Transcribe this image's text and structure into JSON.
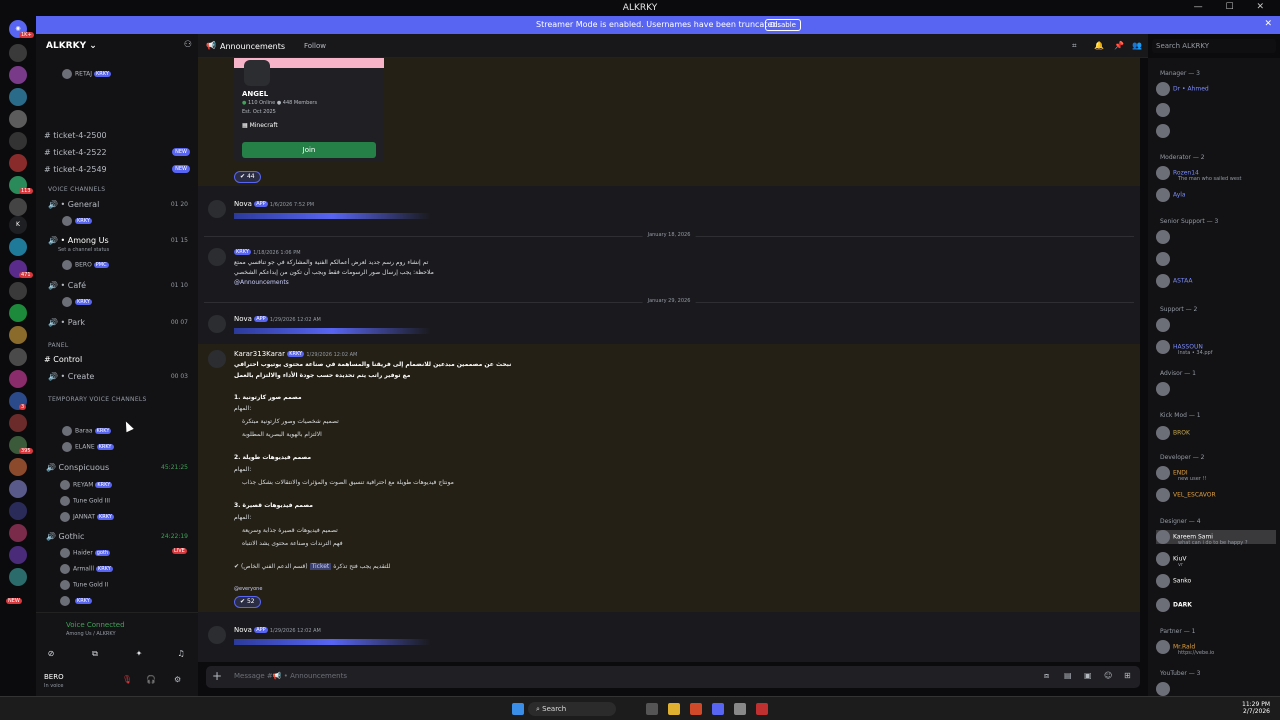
{
  "window": {
    "title": "ALKRKY"
  },
  "banner": {
    "message": "Streamer Mode is enabled. Usernames have been truncated.",
    "disable_label": "Disable"
  },
  "server": {
    "name": "ALKRKY"
  },
  "guild_badges": [
    "1K+",
    "113",
    "471",
    "3",
    "395",
    "NEW"
  ],
  "guild_k": "K",
  "channels": {
    "top_user": {
      "name": "RETAJ",
      "tag": "KRKY"
    },
    "ticket_items": [
      {
        "label": "ticket-4-2500",
        "badge": ""
      },
      {
        "label": "ticket-4-2522",
        "badge": "NEW"
      },
      {
        "label": "ticket-4-2549",
        "badge": "NEW"
      }
    ],
    "voice_category": "VOICE CHANNELS",
    "voice_items": [
      {
        "label": "General",
        "count": "01 20",
        "user": "KRKY",
        "user_name": ""
      },
      {
        "label": "Among Us",
        "count": "01 15",
        "sub": "Set a channel status",
        "user": "PMC",
        "user_name": "BERO"
      },
      {
        "label": "Café",
        "count": "01 10",
        "user": "KRKY",
        "user_name": ""
      },
      {
        "label": "Park",
        "count": "00 07"
      }
    ],
    "panel_category": "PANEL",
    "panel_items": [
      {
        "label": "Control"
      },
      {
        "label": "Create",
        "count": "00 03"
      }
    ],
    "temp_category": "TEMPORARY VOICE CHANNELS",
    "temp_users": [
      {
        "name": "Baraa",
        "tag": "KRKY"
      },
      {
        "name": "ELANE",
        "tag": "KRKY"
      }
    ],
    "conspicuous": {
      "label": "Conspicuous",
      "time": "45:21:25",
      "users": [
        {
          "name": "REYAM",
          "tag": "KRKY"
        },
        {
          "name": "Tune Gold III",
          "tag": ""
        },
        {
          "name": "JANNAT",
          "tag": "KRKY"
        }
      ]
    },
    "gothic": {
      "label": "Gothic",
      "time": "24:22:19",
      "live": "LIVE",
      "users": [
        {
          "name": "Haider",
          "tag": "goth"
        },
        {
          "name": "Armalll",
          "tag": "KRKY"
        },
        {
          "name": "Tune Gold II",
          "tag": ""
        },
        {
          "name": "",
          "tag": "KRKY"
        }
      ]
    }
  },
  "voice_connected": {
    "status": "Voice Connected",
    "location": "Among Us / ALKRKY"
  },
  "current_user": {
    "name": "BERO",
    "status": "In voice"
  },
  "topbar": {
    "channel": "Announcements",
    "follow": "Follow",
    "search_placeholder": "Search ALKRKY"
  },
  "invite_card": {
    "name": "ANGEL",
    "online": "110 Online",
    "members": "448 Members",
    "est": "Est. Oct 2025",
    "game": "Minecraft",
    "join": "Join",
    "reaction": "44"
  },
  "messages": [
    {
      "author": "Nova",
      "badge": "APP",
      "time": "1/6/2026 7:52 PM"
    },
    {
      "author": "",
      "tag": "KRKY",
      "time": "1/18/2026 1:06 PM",
      "line1": "تم إنشاء روم رسم جديد لعرض أعمالكم الفنية والمشاركة في جو تنافسي ممتع",
      "line2": "ملاحظة: يجب إرسال صور الرسومات فقط ويجب أن تكون من إبداعكم الشخصي",
      "mention": "@Announcements"
    },
    {
      "author": "Nova",
      "badge": "APP",
      "time": "1/29/2026 12:02 AM"
    },
    {
      "author": "Karar313Karar",
      "tag": "KRKY",
      "time": "1/29/2026 12:02 AM",
      "lines": [
        "نبحث عن مصممين مبدعين للانضمام إلى فريقنا والمساهمة في صناعة محتوى يوتيوب احترافي",
        "مع توفير راتب يتم تحديده حسب جودة الأداء والالتزام بالعمل",
        "1. مصمم صور كارتونية",
        "المهام:",
        "تصميم شخصيات وصور كارتونية مبتكرة",
        "الالتزام بالهوية البصرية المطلوبة",
        "2. مصمم فيديوهات طويلة",
        "المهام:",
        "مونتاج فيديوهات طويلة مع احترافية تنسيق الصوت والمؤثرات والانتقالات بشكل جذاب",
        "3. مصمم فيديوهات قصيرة",
        "المهام:",
        "تصميم فيديوهات قصيرة جذابة وسريعة",
        "فهم الترندات وصناعة محتوى يشد الانتباه"
      ],
      "apply": "للتقديم يجب فتح تذكرة",
      "ticket": "Ticket",
      "ticket_note": "(قسم الدعم الفني الخاص)",
      "everyone": "@everyone",
      "reaction": "52"
    },
    {
      "author": "Nova",
      "badge": "APP",
      "time": "1/29/2026 12:02 AM"
    }
  ],
  "dates": [
    "January 18, 2026",
    "January 29, 2026"
  ],
  "composer": {
    "placeholder": "Message #📢 • Announcements"
  },
  "member_groups": [
    {
      "label": "Manager — 3",
      "members": [
        "Dr • Ahmed",
        "",
        ""
      ]
    },
    {
      "label": "Moderator — 2",
      "members": [
        "Rozen14",
        "Ayla"
      ]
    },
    {
      "label": "Senior Support — 3",
      "members": [
        "",
        "",
        "ASTAA"
      ]
    },
    {
      "label": "Support — 2",
      "members": [
        "",
        "HASSOUN"
      ]
    },
    {
      "label": "Advisor — 1",
      "members": [
        ""
      ]
    },
    {
      "label": "Kick Mod — 1",
      "members": [
        "BROK"
      ]
    },
    {
      "label": "Developer — 2",
      "members": [
        "ENDI",
        "VEL_ESCAVOR"
      ]
    },
    {
      "label": "Designer — 4",
      "members": [
        "Kareem Sami",
        "KiuV",
        "Sanko",
        "DARK"
      ]
    },
    {
      "label": "Partner — 1",
      "members": [
        "Mr.Rald"
      ]
    },
    {
      "label": "YouTuber — 3",
      "members": [
        ""
      ]
    }
  ],
  "member_subtexts": {
    "rozen": "The man who sailed west",
    "hassoun": "Insta • 34.ppf",
    "kareem": "what can i do to be happy ?",
    "endi": "new user !!",
    "kiuv": "vr",
    "mr_rald": "https://vebe.io"
  },
  "taskbar": {
    "search": "Search",
    "time": "11:29 PM",
    "date": "2/7/2026"
  }
}
